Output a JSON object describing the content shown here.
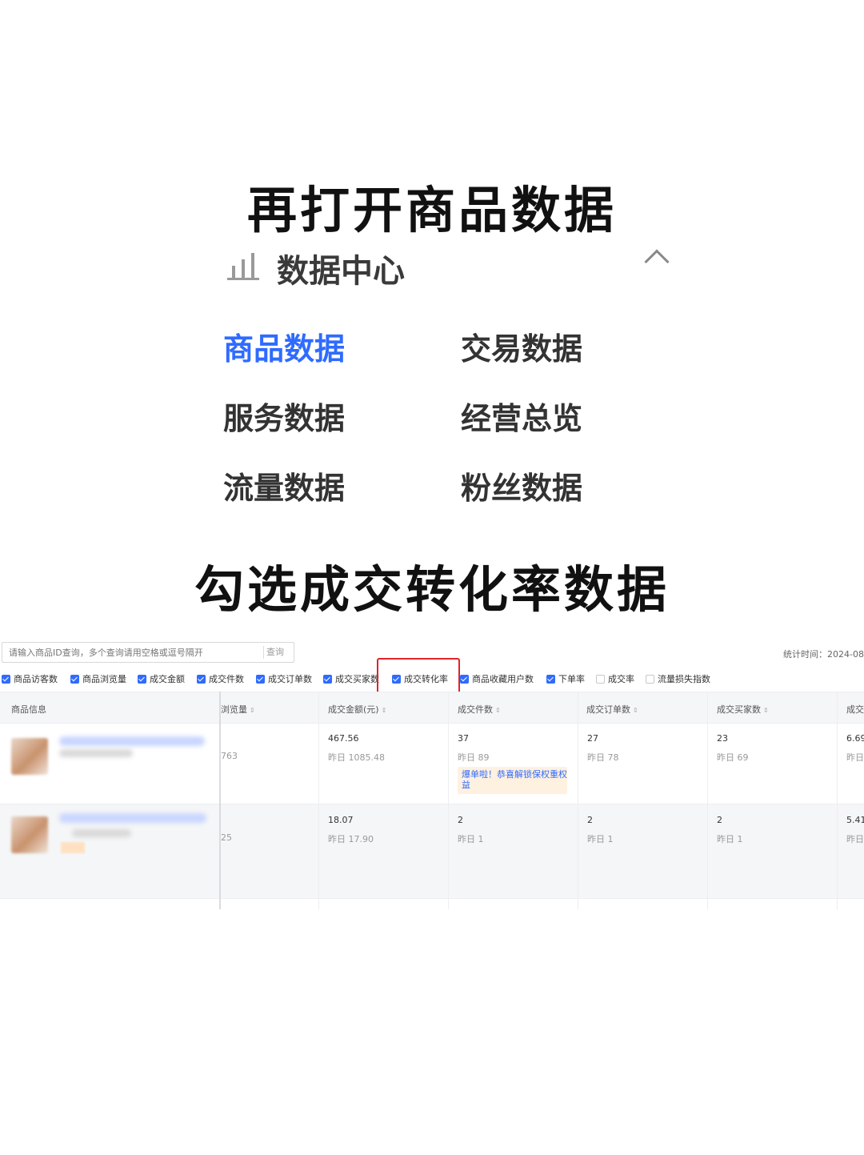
{
  "headline_top": "再打开商品数据",
  "headline_bottom": "勾选成交转化率数据",
  "data_center_menu": {
    "title": "数据中心",
    "bar_chart_icon": "bar-chart-icon",
    "collapse_icon": "chevron-up-icon",
    "items": [
      "商品数据",
      "交易数据",
      "服务数据",
      "经营总览",
      "流量数据",
      "粉丝数据"
    ],
    "active_item": "商品数据",
    "active_color": "#2f6bff"
  },
  "product_data_panel": {
    "search": {
      "placeholder": "请输入商品ID查询，多个查询请用空格或逗号隔开",
      "button_label": "查询"
    },
    "stat_time": "统计时间：2024-08",
    "metric_checkboxes": [
      {
        "label": "商品访客数",
        "checked": true
      },
      {
        "label": "商品浏览量",
        "checked": true
      },
      {
        "label": "成交金额",
        "checked": true
      },
      {
        "label": "成交件数",
        "checked": true
      },
      {
        "label": "成交订单数",
        "checked": true
      },
      {
        "label": "成交买家数",
        "checked": true
      },
      {
        "label": "成交转化率",
        "checked": true,
        "highlighted": true
      },
      {
        "label": "商品收藏用户数",
        "checked": true
      },
      {
        "label": "下单率",
        "checked": true
      },
      {
        "label": "成交率",
        "checked": false
      },
      {
        "label": "流量损失指数",
        "checked": false
      }
    ],
    "highlight_color": "#e0242a",
    "table": {
      "headers": [
        "商品信息",
        "浏览量",
        "成交金额(元)",
        "成交件数",
        "成交订单数",
        "成交买家数",
        "成交"
      ],
      "rows": [
        {
          "views": "763",
          "amount": "467.56",
          "amount_yesterday": "昨日 1085.48",
          "pieces": "37",
          "pieces_yesterday": "昨日 89",
          "notice": "爆单啦！恭喜解锁保权重权益",
          "orders": "27",
          "orders_yesterday": "昨日 78",
          "buyers": "23",
          "buyers_yesterday": "昨日 69",
          "conversion": "6.69",
          "conversion_yesterday": "昨日"
        },
        {
          "views": "25",
          "amount": "18.07",
          "amount_yesterday": "昨日 17.90",
          "pieces": "2",
          "pieces_yesterday": "昨日 1",
          "orders": "2",
          "orders_yesterday": "昨日 1",
          "buyers": "2",
          "buyers_yesterday": "昨日 1",
          "conversion": "5.41",
          "conversion_yesterday": "昨日"
        }
      ]
    }
  }
}
